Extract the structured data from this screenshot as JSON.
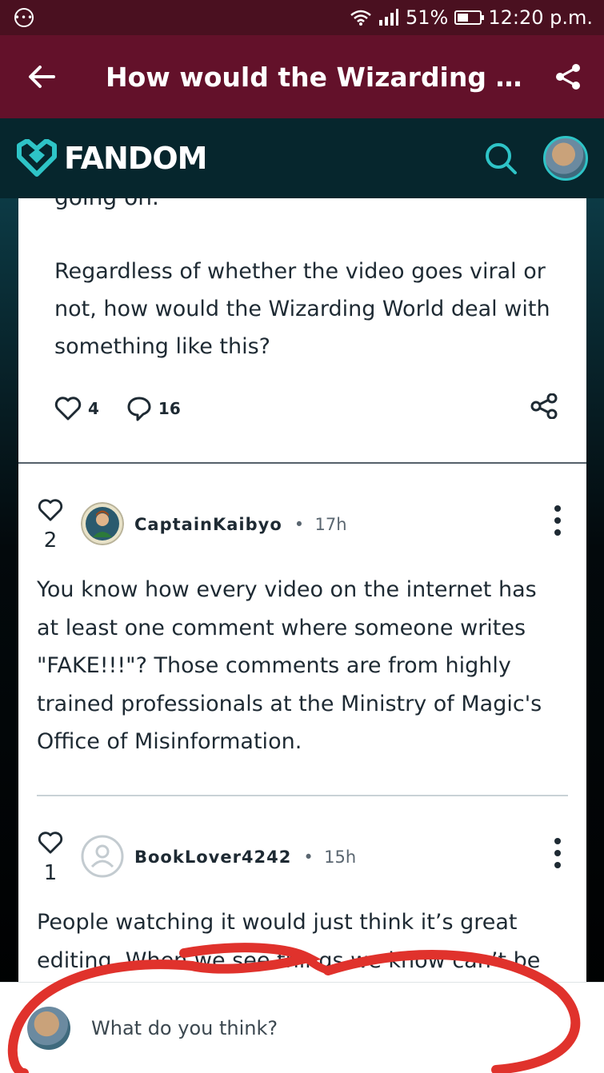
{
  "status_bar": {
    "battery": "51%",
    "battery_level": 0.51,
    "time": "12:20 p.m."
  },
  "app_bar": {
    "title": "How would the Wizarding Wo..."
  },
  "fandom": {
    "brand": "FANDOM"
  },
  "post": {
    "cut_text": "going on.",
    "text": "Regardless of whether the video goes viral or not, how would the Wizarding World deal with something like this?",
    "likes": "4",
    "replies": "16"
  },
  "comments": [
    {
      "likes": "2",
      "user": "CaptainKaibyo",
      "time": "17h",
      "text": "You know how every video on the internet has at least one comment where someone writes \"FAKE!!!\"? Those comments are from highly trained professionals at the Ministry of Magic's Office of Misinformation."
    },
    {
      "likes": "1",
      "user": "BookLover4242",
      "time": "15h",
      "text": "People watching it would just think it’s great editing. When we see things we know can’t be"
    }
  ],
  "composer": {
    "placeholder": "What do you think?"
  },
  "colors": {
    "status_bar": "#4a1020",
    "app_bar": "#63112a",
    "fandom_header": "#06262d",
    "accent": "#2ec4c7",
    "scribble": "#e0322c"
  }
}
